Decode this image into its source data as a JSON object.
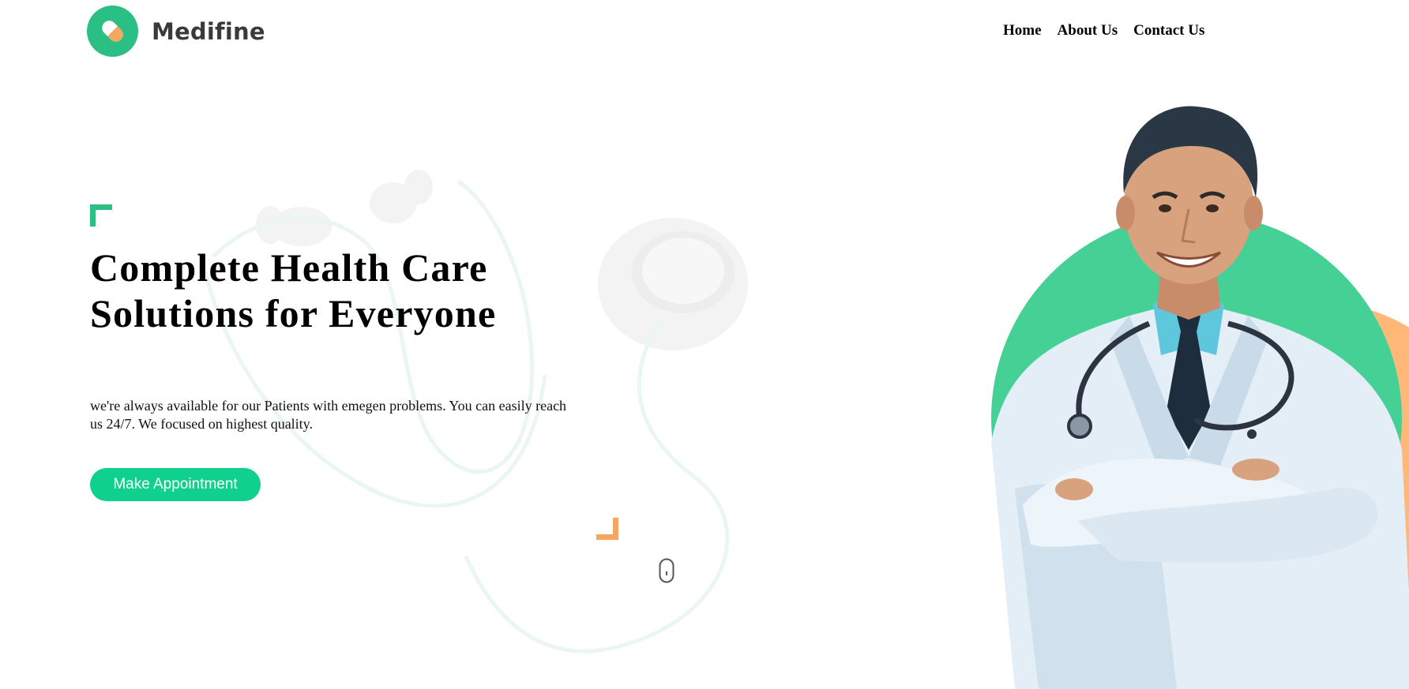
{
  "brand": {
    "name": "Medifine",
    "logo_icon": "pill-icon",
    "accent": "#2cbf84"
  },
  "nav": {
    "items": [
      {
        "label": "Home"
      },
      {
        "label": "About Us"
      },
      {
        "label": "Contact Us"
      }
    ]
  },
  "hero": {
    "title": "Complete Health Care Solutions for Everyone",
    "description_lines": [
      "we're always available for our Patients with emegen problems. You can easily reach",
      "us 24/7. We focused on highest quality."
    ],
    "cta_label": "Make Appointment",
    "cta_color": "#0fd08d",
    "bracket_color_top": "#2cbf84",
    "bracket_color_bottom": "#f4a762",
    "scroll_icon": "mouse-scroll-icon"
  },
  "illustration": {
    "subject": "doctor-illustration",
    "circle_color": "#45d096",
    "secondary_circle_color": "#ffb877"
  }
}
